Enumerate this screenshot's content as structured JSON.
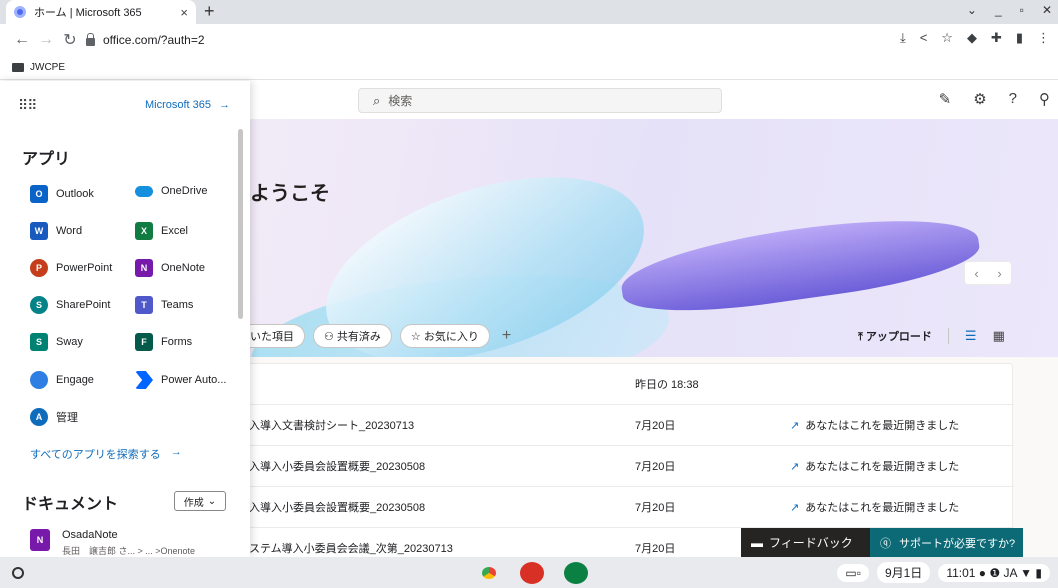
{
  "browser": {
    "tab_title": "ホーム | Microsoft 365",
    "tab_close": "×",
    "new_tab": "+",
    "url": "office.com/?auth=2",
    "bookmark": "JWCPE",
    "window_controls": [
      "⌄",
      "_",
      "▫",
      "✕"
    ]
  },
  "office": {
    "search_placeholder": "検索",
    "welcome": "ようこそ",
    "filters": [
      "いた項目",
      "共有済み",
      "お気に入り"
    ],
    "upload": "アップロード",
    "files": [
      {
        "name": "",
        "date": "昨日の 18:38",
        "activity": ""
      },
      {
        "name": "入導入文書検討シート_20230713",
        "date": "7月20日",
        "activity": "あなたはこれを最近開きました"
      },
      {
        "name": "入導入小委員会設置概要_20230508",
        "date": "7月20日",
        "activity": "あなたはこれを最近開きました"
      },
      {
        "name": "入導入小委員会設置概要_20230508",
        "date": "7月20日",
        "activity": "あなたはこれを最近開きました"
      },
      {
        "name": "ステム導入小委員会会議_次第_20230713",
        "date": "7月20日",
        "activity": ""
      }
    ],
    "feedback": "フィードバック",
    "support": "サポートが必要ですか?"
  },
  "launcher_panel": {
    "m365_link": "Microsoft 365",
    "apps_heading": "アプリ",
    "apps": [
      {
        "name": "Outlook",
        "letter": "O",
        "color": "#0a64c8"
      },
      {
        "name": "OneDrive",
        "letter": "",
        "color": "#1490df"
      },
      {
        "name": "Word",
        "letter": "W",
        "color": "#185abd"
      },
      {
        "name": "Excel",
        "letter": "X",
        "color": "#107c41"
      },
      {
        "name": "PowerPoint",
        "letter": "P",
        "color": "#c43e1c"
      },
      {
        "name": "OneNote",
        "letter": "N",
        "color": "#7719aa"
      },
      {
        "name": "SharePoint",
        "letter": "S",
        "color": "#038387"
      },
      {
        "name": "Teams",
        "letter": "T",
        "color": "#5059c9"
      },
      {
        "name": "Sway",
        "letter": "S",
        "color": "#008272"
      },
      {
        "name": "Forms",
        "letter": "F",
        "color": "#035a4a"
      },
      {
        "name": "Engage",
        "letter": "",
        "color": "#2f7ee4"
      },
      {
        "name": "Power Auto...",
        "letter": "",
        "color": "#0066ff"
      },
      {
        "name": "管理",
        "letter": "A",
        "color": "#0f6cbd"
      }
    ],
    "explore": "すべてのアプリを探索する",
    "docs_heading": "ドキュメント",
    "create": "作成",
    "doc_title": "OsadaNote",
    "doc_sub": "長田　譲吉郎 さ... > ... >Onenote"
  },
  "shelf": {
    "date": "9月1日",
    "time": "11:01",
    "ime": "JA"
  }
}
